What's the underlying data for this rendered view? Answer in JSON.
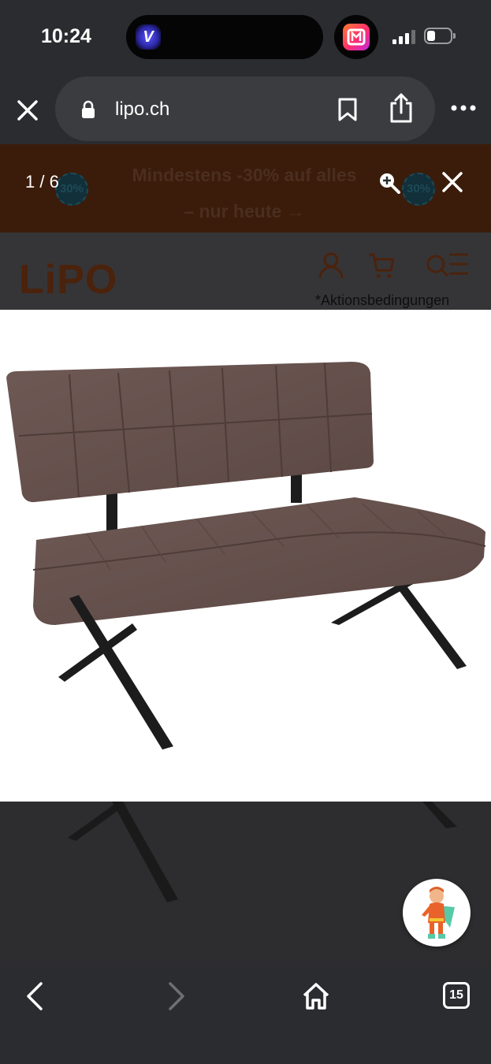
{
  "status_bar": {
    "time": "10:24",
    "island_app_letter": "V",
    "battery_level": 0.35
  },
  "browser": {
    "url": "lipo.ch",
    "icons": [
      "close-icon",
      "lock-icon",
      "bookmark-icon",
      "share-icon",
      "more-icon"
    ]
  },
  "promo_banner": {
    "line1": "Mindestens -30% auf alles",
    "line2": "– nur heute →",
    "badge": "30%"
  },
  "site_header": {
    "logo": "LiPO",
    "fineprint": "*Aktionsbedingungen",
    "icons": [
      "user-icon",
      "cart-icon",
      "search-menu-icon"
    ]
  },
  "gallery": {
    "counter": "1 / 6",
    "icons": [
      "zoom-in-icon",
      "close-icon"
    ],
    "colors": {
      "upholstery": "#6b5550",
      "legs": "#1c1c1c"
    }
  },
  "bottom_bar": {
    "tabs_count": "15",
    "icons": [
      "back-icon",
      "forward-icon",
      "home-icon",
      "tabs-icon"
    ]
  }
}
